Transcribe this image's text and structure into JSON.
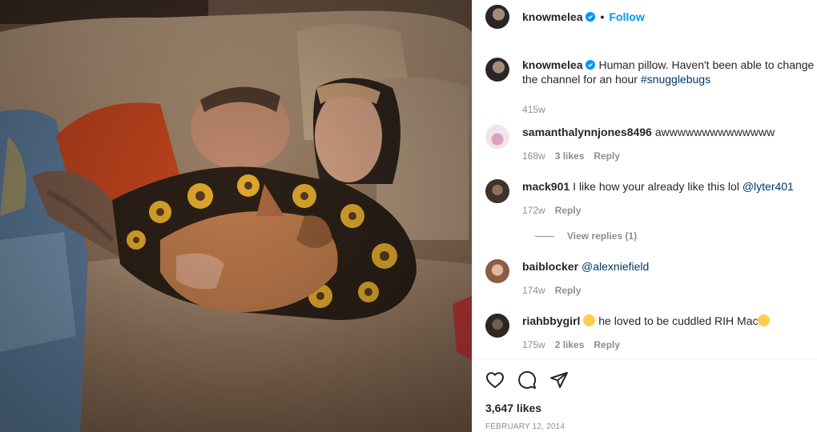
{
  "post": {
    "author": "knowmelea",
    "follow_label": "Follow",
    "separator": "•",
    "verified_icon": "verified-badge-icon",
    "accent": "#0095f6",
    "caption": {
      "username": "knowmelea",
      "text": "Human pillow. Haven't been able to change the channel for an hour",
      "hashtag": "#snugglebugs",
      "time": "415w"
    },
    "comments": [
      {
        "username": "samanthalynnjones8496",
        "text": "awwwwwwwwwwwwww",
        "time": "168w",
        "likes": "3 likes",
        "reply": "Reply",
        "avatar_color": "#e9c7d6"
      },
      {
        "username": "mack901",
        "text": "I like how your already like this lol",
        "mention": "@lyter401",
        "time": "172w",
        "reply": "Reply",
        "view_replies": "View replies (1)",
        "avatar_color": "#6b5a4a"
      },
      {
        "username": "baiblocker",
        "mention": "@alexniefield",
        "time": "174w",
        "reply": "Reply",
        "avatar_color": "#c79a7a"
      },
      {
        "username": "riahbbygirl",
        "text": "he loved to be cuddled RIH Mac",
        "emoji_before": "weary-face-emoji",
        "emoji_after": "crying-face-emoji",
        "time": "175w",
        "likes": "2 likes",
        "reply": "Reply",
        "avatar_color": "#4a4038"
      }
    ],
    "actions": {
      "like_icon": "heart-icon",
      "comment_icon": "comment-icon",
      "share_icon": "share-icon"
    },
    "likes": "3,647 likes",
    "date": "February 12, 2014"
  }
}
